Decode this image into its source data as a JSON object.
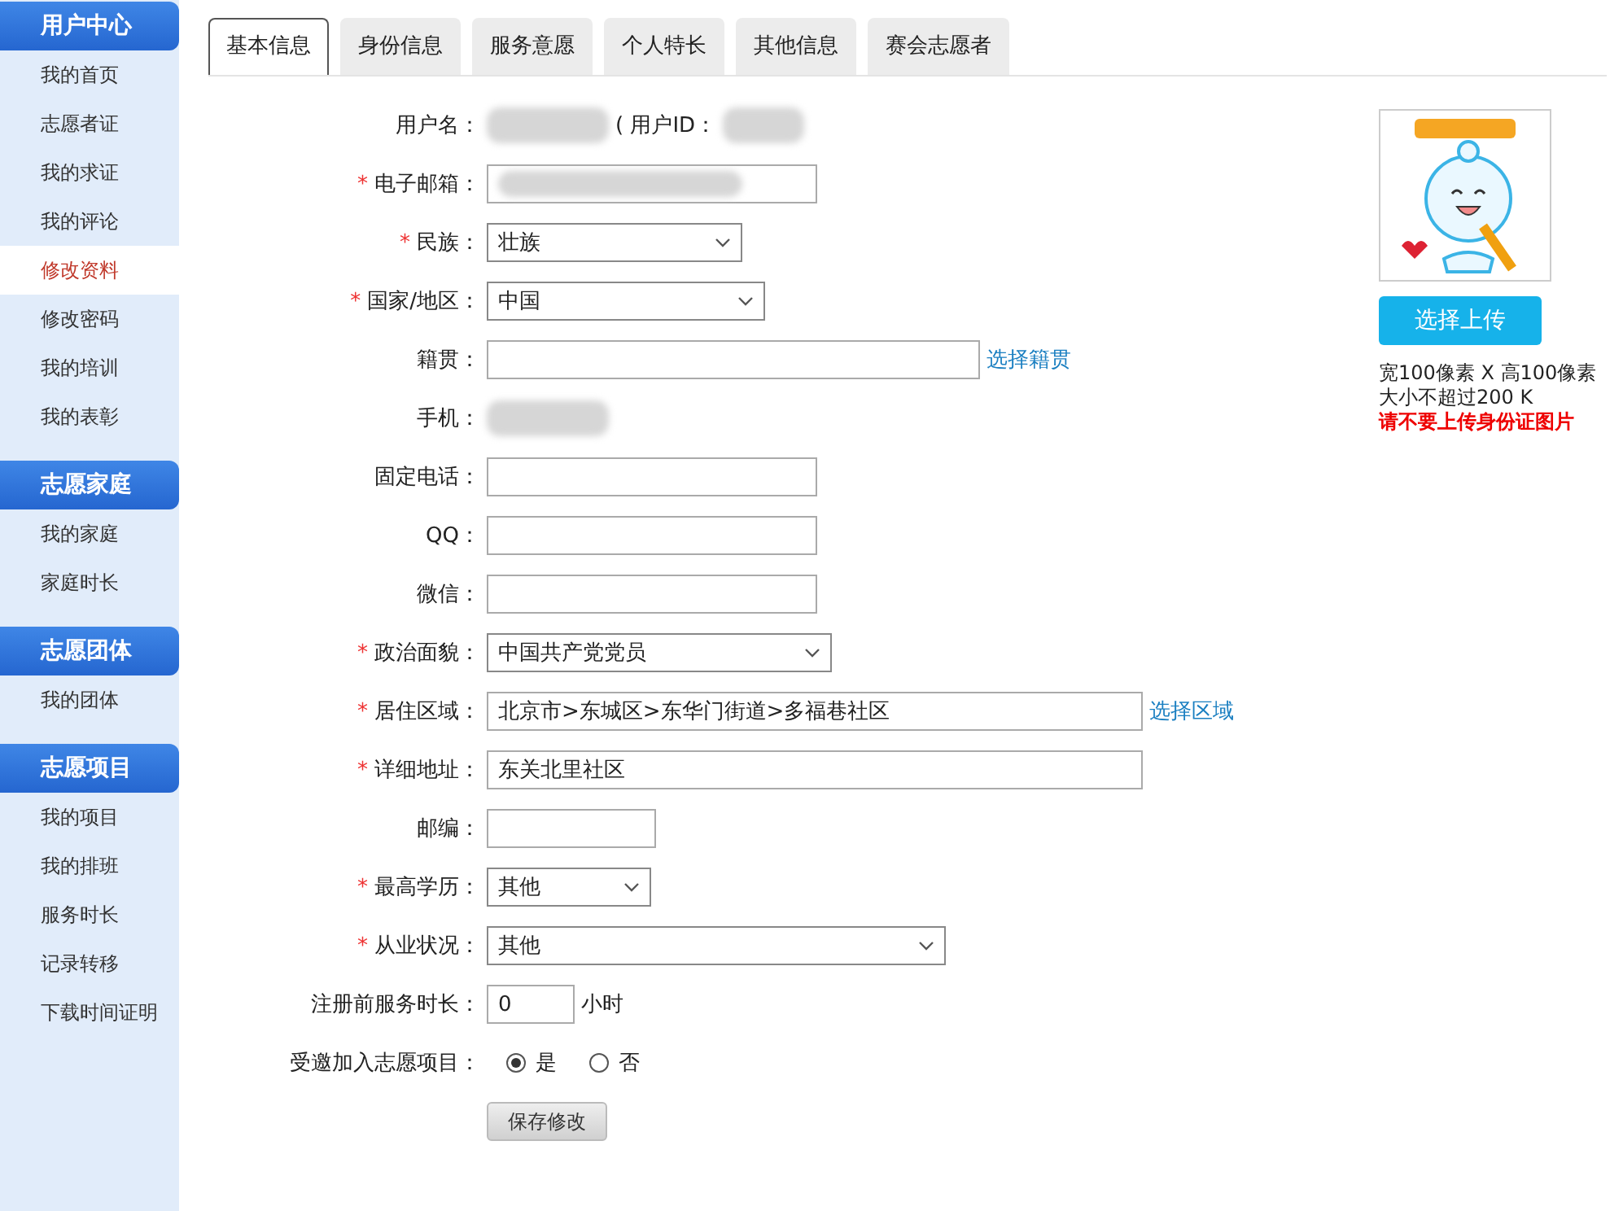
{
  "sidebar": {
    "sections": [
      {
        "title": "用户中心",
        "items": [
          {
            "label": "我的首页",
            "selected": false
          },
          {
            "label": "志愿者证",
            "selected": false
          },
          {
            "label": "我的求证",
            "selected": false
          },
          {
            "label": "我的评论",
            "selected": false
          },
          {
            "label": "修改资料",
            "selected": true
          },
          {
            "label": "修改密码",
            "selected": false
          },
          {
            "label": "我的培训",
            "selected": false
          },
          {
            "label": "我的表彰",
            "selected": false
          }
        ]
      },
      {
        "title": "志愿家庭",
        "items": [
          {
            "label": "我的家庭",
            "selected": false
          },
          {
            "label": "家庭时长",
            "selected": false
          }
        ]
      },
      {
        "title": "志愿团体",
        "items": [
          {
            "label": "我的团体",
            "selected": false
          }
        ]
      },
      {
        "title": "志愿项目",
        "items": [
          {
            "label": "我的项目",
            "selected": false
          },
          {
            "label": "我的排班",
            "selected": false
          },
          {
            "label": "服务时长",
            "selected": false
          },
          {
            "label": "记录转移",
            "selected": false
          },
          {
            "label": "下载时间证明",
            "selected": false
          }
        ]
      }
    ]
  },
  "tabs": [
    {
      "label": "基本信息",
      "selected": true
    },
    {
      "label": "身份信息",
      "selected": false
    },
    {
      "label": "服务意愿",
      "selected": false
    },
    {
      "label": "个人特长",
      "selected": false
    },
    {
      "label": "其他信息",
      "selected": false
    },
    {
      "label": "赛会志愿者",
      "selected": false
    }
  ],
  "form": {
    "rows": [
      {
        "kind": "redacted",
        "label": "用户名：",
        "suffix": "( 用户ID："
      },
      {
        "kind": "input",
        "label": "电子邮箱：",
        "required_mark": "*",
        "redacted": true
      },
      {
        "kind": "select",
        "label": "民族：",
        "required_mark": "*",
        "value": "壮族"
      },
      {
        "kind": "select",
        "label": "国家/地区：",
        "required_mark": "*",
        "value": "中国"
      },
      {
        "kind": "input",
        "label": "籍贯：",
        "link": "选择籍贯"
      },
      {
        "kind": "redacted",
        "label": "手机："
      },
      {
        "kind": "input",
        "label": "固定电话："
      },
      {
        "kind": "input",
        "label": "QQ："
      },
      {
        "kind": "input",
        "label": "微信："
      },
      {
        "kind": "select",
        "label": "政治面貌：",
        "required_mark": "*",
        "value": "中国共产党党员"
      },
      {
        "kind": "input",
        "label": "居住区域：",
        "required_mark": "*",
        "value": "北京市>东城区>东华门街道>多福巷社区",
        "link": "选择区域"
      },
      {
        "kind": "input",
        "label": "详细地址：",
        "required_mark": "*",
        "value": "东关北里社区"
      },
      {
        "kind": "input",
        "label": "邮编："
      },
      {
        "kind": "select",
        "label": "最高学历：",
        "required_mark": "*",
        "value": "其他"
      },
      {
        "kind": "select",
        "label": "从业状况：",
        "required_mark": "*",
        "value": "其他"
      },
      {
        "kind": "input",
        "label": "注册前服务时长：",
        "value": "0",
        "unit": "小时"
      },
      {
        "kind": "radio",
        "label": "受邀加入志愿项目：",
        "options": [
          {
            "label": "是",
            "selected": true
          },
          {
            "label": "否",
            "selected": false
          }
        ]
      },
      {
        "kind": "submit",
        "button": "保存修改"
      }
    ]
  },
  "avatar": {
    "upload_button": "选择上传",
    "hints": [
      "宽100像素 X 高100像素",
      "大小不超过200 K"
    ],
    "warning": "请不要上传身份证图片"
  }
}
